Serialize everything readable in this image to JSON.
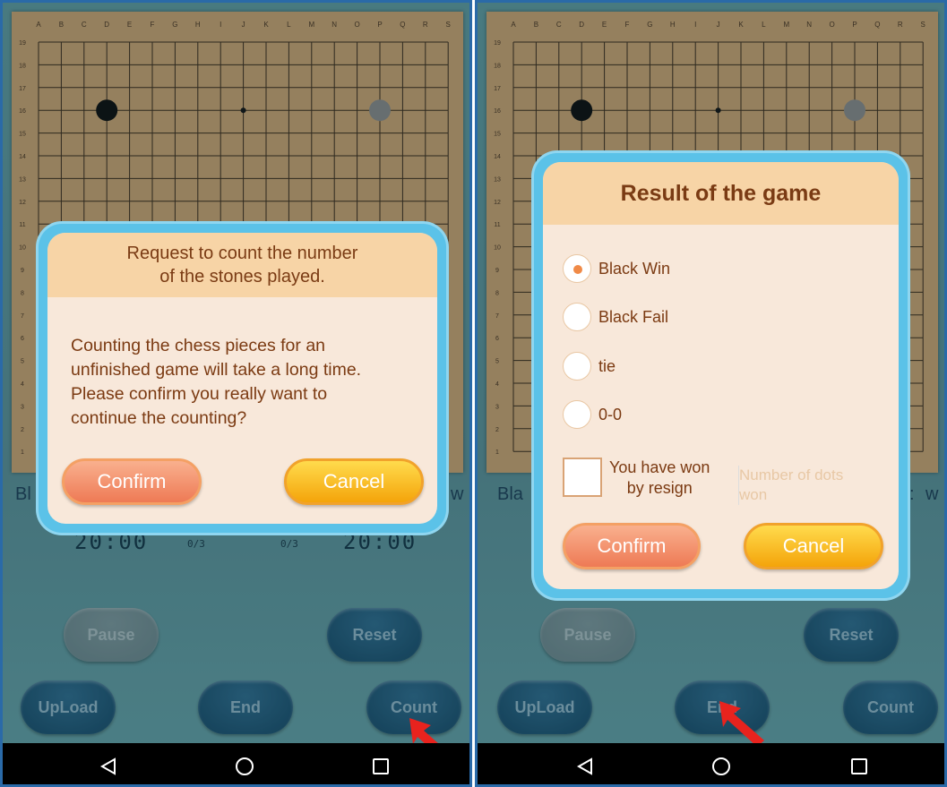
{
  "board": {
    "columns": [
      "A",
      "B",
      "C",
      "D",
      "E",
      "F",
      "G",
      "H",
      "I",
      "J",
      "K",
      "L",
      "M",
      "N",
      "O",
      "P",
      "Q",
      "R",
      "S"
    ],
    "rows": [
      "19",
      "18",
      "17",
      "16",
      "15",
      "14",
      "13",
      "12",
      "11",
      "10",
      "9",
      "8",
      "7",
      "6",
      "5",
      "4",
      "3",
      "2",
      "1"
    ]
  },
  "left": {
    "players": {
      "black_label": "Bl",
      "white_label": "w"
    },
    "timers": {
      "black": "20:00",
      "white": "20:00",
      "black_count": "0/3",
      "white_count": "0/3"
    },
    "controls": {
      "pause": "Pause",
      "reset": "Reset",
      "upload": "UpLoad",
      "end": "End",
      "count": "Count"
    },
    "dialog": {
      "title_line1": "Request to count the number",
      "title_line2": "of the stones played.",
      "body_line1": "Counting the chess pieces for an",
      "body_line2": "unfinished game will take a long time.",
      "body_line3": "Please confirm you really want to",
      "body_line4": "continue the counting?",
      "confirm": "Confirm",
      "cancel": "Cancel"
    }
  },
  "right": {
    "players": {
      "black_label": "Bla",
      "white_label": "w",
      "white_fragment": ":"
    },
    "controls": {
      "pause": "Pause",
      "reset": "Reset",
      "upload": "UpLoad",
      "end": "End",
      "count": "Count"
    },
    "dialog": {
      "title": "Result of the game",
      "options": [
        "Black Win",
        "Black Fail",
        "tie",
        "0-0"
      ],
      "selected_option": "Black Win",
      "resign_line1": "You have won",
      "resign_line2": "by resign",
      "dots_placeholder_line1": "Number of dots",
      "dots_placeholder_line2": "won",
      "confirm": "Confirm",
      "cancel": "Cancel"
    }
  },
  "colors": {
    "accent_orange": "#ee7a55",
    "accent_yellow": "#f4a40a",
    "dialog_frame": "#5bc2e8",
    "arrow": "#e8231e"
  }
}
